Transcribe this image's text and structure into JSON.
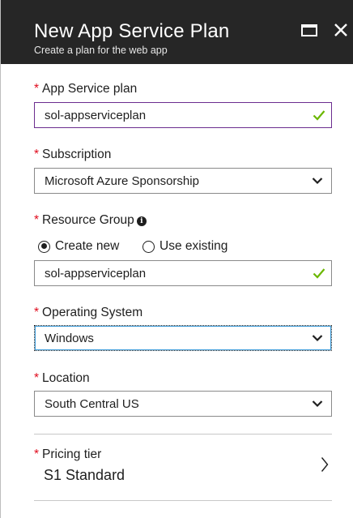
{
  "header": {
    "title": "New App Service Plan",
    "subtitle": "Create a plan for the web app"
  },
  "form": {
    "required_marker": "*",
    "app_service_plan": {
      "label": "App Service plan",
      "value": "sol-appserviceplan",
      "valid": true
    },
    "subscription": {
      "label": "Subscription",
      "value": "Microsoft Azure Sponsorship"
    },
    "resource_group": {
      "label": "Resource Group",
      "info_glyph": "i",
      "radio_create_new": "Create new",
      "radio_use_existing": "Use existing",
      "selected_option": "Create new",
      "value": "sol-appserviceplan",
      "valid": true
    },
    "operating_system": {
      "label": "Operating System",
      "value": "Windows"
    },
    "location": {
      "label": "Location",
      "value": "South Central US"
    },
    "pricing_tier": {
      "label": "Pricing tier",
      "value": "S1 Standard"
    }
  },
  "colors": {
    "header_bg": "#262626",
    "required": "#e00b1c",
    "valid_check": "#6bb700",
    "focus_border": "#6b2d8f"
  },
  "icons": {
    "maximize": "maximize-icon",
    "close": "close-icon",
    "check": "checkmark-icon",
    "dropdown": "chevron-down-icon",
    "info": "info-icon",
    "navigate": "chevron-right-icon"
  }
}
